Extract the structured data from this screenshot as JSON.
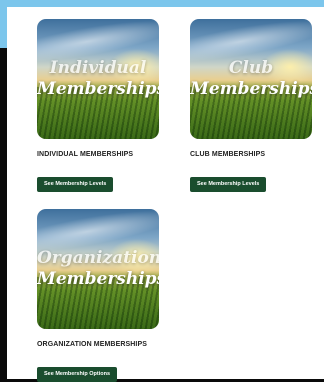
{
  "cards": [
    {
      "image_title_line1": "Individual",
      "image_title_line2": "Memberships",
      "label": "INDIVIDUAL MEMBERSHIPS",
      "button_label": "See Membership Levels"
    },
    {
      "image_title_line1": "Club",
      "image_title_line2": "Memberships",
      "label": "CLUB MEMBERSHIPS",
      "button_label": "See Membership Levels"
    },
    {
      "image_title_line1": "Organization",
      "image_title_line2": "Memberships",
      "label": "ORGANIZATION MEMBERSHIPS",
      "button_label": "See Membership Options"
    }
  ],
  "colors": {
    "button_bg": "#1a4d2e",
    "accent_strip": "#7cc6ec",
    "background": "#0a0a0a"
  }
}
